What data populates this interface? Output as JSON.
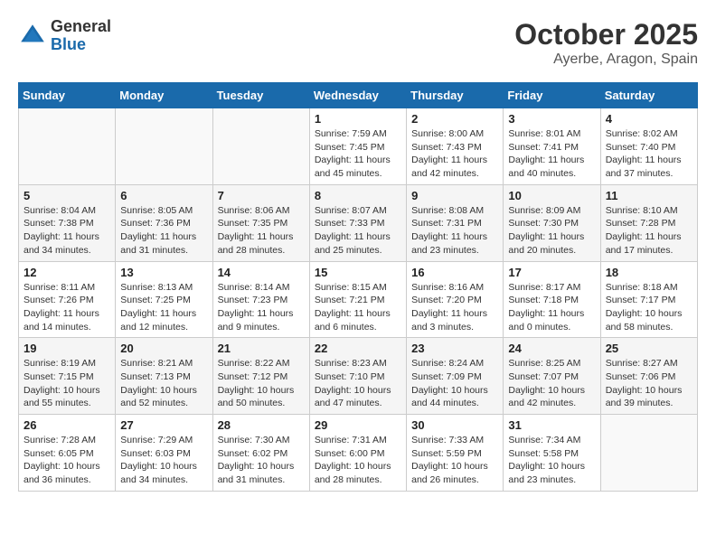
{
  "logo": {
    "general": "General",
    "blue": "Blue"
  },
  "title": "October 2025",
  "subtitle": "Ayerbe, Aragon, Spain",
  "days_header": [
    "Sunday",
    "Monday",
    "Tuesday",
    "Wednesday",
    "Thursday",
    "Friday",
    "Saturday"
  ],
  "weeks": [
    [
      {
        "day": "",
        "info": ""
      },
      {
        "day": "",
        "info": ""
      },
      {
        "day": "",
        "info": ""
      },
      {
        "day": "1",
        "info": "Sunrise: 7:59 AM\nSunset: 7:45 PM\nDaylight: 11 hours\nand 45 minutes."
      },
      {
        "day": "2",
        "info": "Sunrise: 8:00 AM\nSunset: 7:43 PM\nDaylight: 11 hours\nand 42 minutes."
      },
      {
        "day": "3",
        "info": "Sunrise: 8:01 AM\nSunset: 7:41 PM\nDaylight: 11 hours\nand 40 minutes."
      },
      {
        "day": "4",
        "info": "Sunrise: 8:02 AM\nSunset: 7:40 PM\nDaylight: 11 hours\nand 37 minutes."
      }
    ],
    [
      {
        "day": "5",
        "info": "Sunrise: 8:04 AM\nSunset: 7:38 PM\nDaylight: 11 hours\nand 34 minutes."
      },
      {
        "day": "6",
        "info": "Sunrise: 8:05 AM\nSunset: 7:36 PM\nDaylight: 11 hours\nand 31 minutes."
      },
      {
        "day": "7",
        "info": "Sunrise: 8:06 AM\nSunset: 7:35 PM\nDaylight: 11 hours\nand 28 minutes."
      },
      {
        "day": "8",
        "info": "Sunrise: 8:07 AM\nSunset: 7:33 PM\nDaylight: 11 hours\nand 25 minutes."
      },
      {
        "day": "9",
        "info": "Sunrise: 8:08 AM\nSunset: 7:31 PM\nDaylight: 11 hours\nand 23 minutes."
      },
      {
        "day": "10",
        "info": "Sunrise: 8:09 AM\nSunset: 7:30 PM\nDaylight: 11 hours\nand 20 minutes."
      },
      {
        "day": "11",
        "info": "Sunrise: 8:10 AM\nSunset: 7:28 PM\nDaylight: 11 hours\nand 17 minutes."
      }
    ],
    [
      {
        "day": "12",
        "info": "Sunrise: 8:11 AM\nSunset: 7:26 PM\nDaylight: 11 hours\nand 14 minutes."
      },
      {
        "day": "13",
        "info": "Sunrise: 8:13 AM\nSunset: 7:25 PM\nDaylight: 11 hours\nand 12 minutes."
      },
      {
        "day": "14",
        "info": "Sunrise: 8:14 AM\nSunset: 7:23 PM\nDaylight: 11 hours\nand 9 minutes."
      },
      {
        "day": "15",
        "info": "Sunrise: 8:15 AM\nSunset: 7:21 PM\nDaylight: 11 hours\nand 6 minutes."
      },
      {
        "day": "16",
        "info": "Sunrise: 8:16 AM\nSunset: 7:20 PM\nDaylight: 11 hours\nand 3 minutes."
      },
      {
        "day": "17",
        "info": "Sunrise: 8:17 AM\nSunset: 7:18 PM\nDaylight: 11 hours\nand 0 minutes."
      },
      {
        "day": "18",
        "info": "Sunrise: 8:18 AM\nSunset: 7:17 PM\nDaylight: 10 hours\nand 58 minutes."
      }
    ],
    [
      {
        "day": "19",
        "info": "Sunrise: 8:19 AM\nSunset: 7:15 PM\nDaylight: 10 hours\nand 55 minutes."
      },
      {
        "day": "20",
        "info": "Sunrise: 8:21 AM\nSunset: 7:13 PM\nDaylight: 10 hours\nand 52 minutes."
      },
      {
        "day": "21",
        "info": "Sunrise: 8:22 AM\nSunset: 7:12 PM\nDaylight: 10 hours\nand 50 minutes."
      },
      {
        "day": "22",
        "info": "Sunrise: 8:23 AM\nSunset: 7:10 PM\nDaylight: 10 hours\nand 47 minutes."
      },
      {
        "day": "23",
        "info": "Sunrise: 8:24 AM\nSunset: 7:09 PM\nDaylight: 10 hours\nand 44 minutes."
      },
      {
        "day": "24",
        "info": "Sunrise: 8:25 AM\nSunset: 7:07 PM\nDaylight: 10 hours\nand 42 minutes."
      },
      {
        "day": "25",
        "info": "Sunrise: 8:27 AM\nSunset: 7:06 PM\nDaylight: 10 hours\nand 39 minutes."
      }
    ],
    [
      {
        "day": "26",
        "info": "Sunrise: 7:28 AM\nSunset: 6:05 PM\nDaylight: 10 hours\nand 36 minutes."
      },
      {
        "day": "27",
        "info": "Sunrise: 7:29 AM\nSunset: 6:03 PM\nDaylight: 10 hours\nand 34 minutes."
      },
      {
        "day": "28",
        "info": "Sunrise: 7:30 AM\nSunset: 6:02 PM\nDaylight: 10 hours\nand 31 minutes."
      },
      {
        "day": "29",
        "info": "Sunrise: 7:31 AM\nSunset: 6:00 PM\nDaylight: 10 hours\nand 28 minutes."
      },
      {
        "day": "30",
        "info": "Sunrise: 7:33 AM\nSunset: 5:59 PM\nDaylight: 10 hours\nand 26 minutes."
      },
      {
        "day": "31",
        "info": "Sunrise: 7:34 AM\nSunset: 5:58 PM\nDaylight: 10 hours\nand 23 minutes."
      },
      {
        "day": "",
        "info": ""
      }
    ]
  ]
}
